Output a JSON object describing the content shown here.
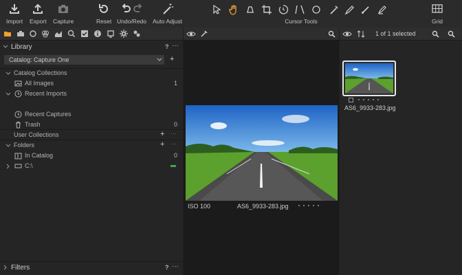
{
  "toolbar": {
    "import_label": "Import",
    "export_label": "Export",
    "capture_label": "Capture",
    "reset_label": "Reset",
    "undo_redo_label": "Undo/Redo",
    "auto_adjust_label": "Auto Adjust",
    "cursor_tools_label": "Cursor Tools",
    "grid_label": "Grid",
    "cursor_tools": [
      "select-cursor-icon",
      "pan-hand-icon",
      "loupe-icon",
      "crop-icon",
      "rotate-icon",
      "keystone-icon",
      "spot-removal-icon",
      "picker-icon",
      "brush-icon",
      "gradient-icon",
      "eraser-icon"
    ],
    "active_cursor_tool": "pan-hand-icon",
    "accent_color": "#f0a030"
  },
  "left_panel": {
    "active_tab_color": "#f0a030",
    "library": {
      "title": "Library",
      "help": "?",
      "more": "···",
      "catalog_select": "Catalog: Capture One"
    },
    "catalog_collections": {
      "title": "Catalog Collections",
      "all_images": {
        "label": "All Images",
        "count": "1"
      },
      "recent_imports": {
        "label": "Recent Imports"
      },
      "recent_captures": {
        "label": "Recent Captures"
      },
      "trash": {
        "label": "Trash",
        "count": "0"
      }
    },
    "user_collections": {
      "title": "User Collections",
      "add": "+",
      "more": "···"
    },
    "folders": {
      "title": "Folders",
      "add": "+",
      "more": "···",
      "in_catalog": {
        "label": "In Catalog",
        "count": "0"
      },
      "drive": {
        "label": "C:\\",
        "status_color": "#3daa4a"
      }
    },
    "filters": {
      "title": "Filters",
      "help": "?",
      "more": "···"
    }
  },
  "viewer": {
    "iso": "ISO 100",
    "filename": "AS6_9933-283.jpg"
  },
  "browser": {
    "selection_status": "1 of 1 selected",
    "thumbnail_filename": "AS6_9933-283.jpg",
    "selection_border_color": "#e8e8e8"
  }
}
